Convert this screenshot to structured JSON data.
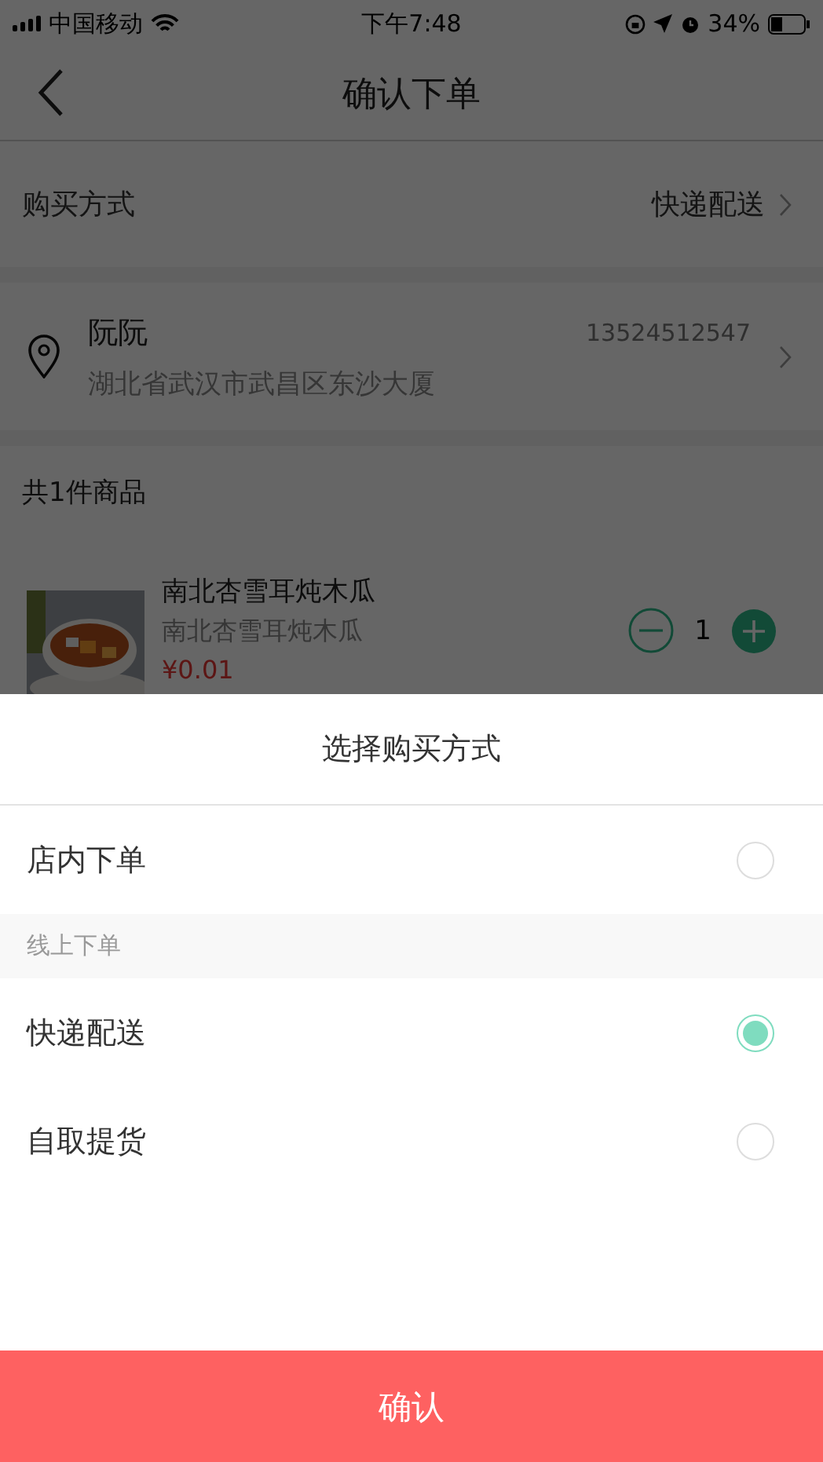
{
  "status_bar": {
    "carrier": "中国移动",
    "time": "下午7:48",
    "battery": "34%"
  },
  "nav": {
    "title": "确认下单"
  },
  "purchase_method": {
    "label": "购买方式",
    "value": "快递配送"
  },
  "address": {
    "name": "阮阮",
    "phone": "13524512547",
    "detail": "湖北省武汉市武昌区东沙大厦"
  },
  "items_header": "共1件商品",
  "product": {
    "name": "南北杏雪耳炖木瓜",
    "subtitle": "南北杏雪耳炖木瓜",
    "price": "¥0.01",
    "quantity": "1"
  },
  "sheet": {
    "title": "选择购买方式",
    "rows": [
      {
        "kind": "option",
        "label": "店内下单",
        "selected": false
      },
      {
        "kind": "header",
        "label": "线上下单"
      },
      {
        "kind": "option",
        "label": "快递配送",
        "selected": true
      },
      {
        "kind": "option",
        "label": "自取提货",
        "selected": false
      }
    ],
    "confirm": "确认"
  }
}
